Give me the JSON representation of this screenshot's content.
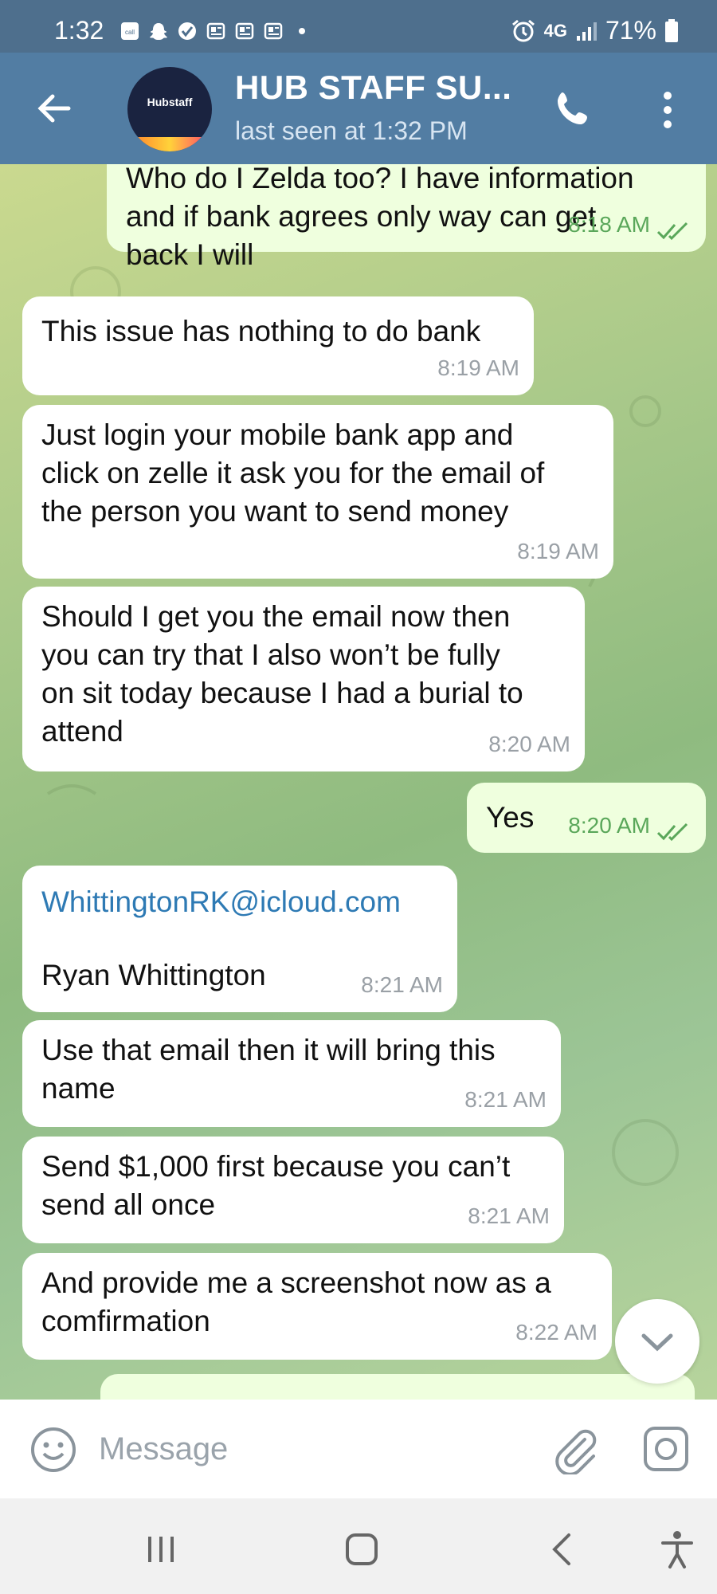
{
  "status_bar": {
    "time": "1:32",
    "network": "4G",
    "battery": "71%",
    "icons": [
      "call-filter-icon",
      "snapchat-icon",
      "verified-icon",
      "news-icon",
      "news-icon",
      "news-icon",
      "dot-icon",
      "alarm-icon",
      "lte-icon",
      "signal-icon",
      "battery-icon"
    ]
  },
  "header": {
    "title": "HUB STAFF SU...",
    "status": "last seen at 1:32 PM",
    "avatar_label": "Hubstaff"
  },
  "messages": [
    {
      "direction": "out",
      "text": "Who do I Zelda too? I have information\nand if bank agrees only way can get\nback I will",
      "time": "8:18 AM",
      "read": true
    },
    {
      "direction": "in",
      "text": "This issue has nothing to do bank",
      "time": "8:19 AM"
    },
    {
      "direction": "in",
      "text": "Just login your mobile bank app and\nclick on zelle it ask you for the email of\nthe person you want to send money",
      "time": "8:19 AM"
    },
    {
      "direction": "in",
      "text": "Should I get you the email now then\nyou can try that I also won’t be fully\non sit today because I had a burial to\nattend",
      "time": "8:20 AM"
    },
    {
      "direction": "out",
      "text": "Yes",
      "time": "8:20 AM",
      "read": true
    },
    {
      "direction": "in",
      "link": "WhittingtonRK@icloud.com",
      "text": "Ryan Whittington",
      "time": "8:21 AM"
    },
    {
      "direction": "in",
      "text": "Use that email then it will bring this\nname",
      "time": "8:21 AM"
    },
    {
      "direction": "in",
      "text": "Send $1,000 first because you can’t\nsend all once",
      "time": "8:21 AM"
    },
    {
      "direction": "in",
      "text": "And provide me a screenshot now as a\ncomfirmation",
      "time": "8:22 AM"
    }
  ],
  "input": {
    "placeholder": "Message"
  },
  "colors": {
    "status_bar": "#4e6f8d",
    "header": "#527da3",
    "outgoing_bubble": "#efffde",
    "incoming_bubble": "#ffffff",
    "read_check": "#5aa75a",
    "link": "#2e7ab4"
  }
}
